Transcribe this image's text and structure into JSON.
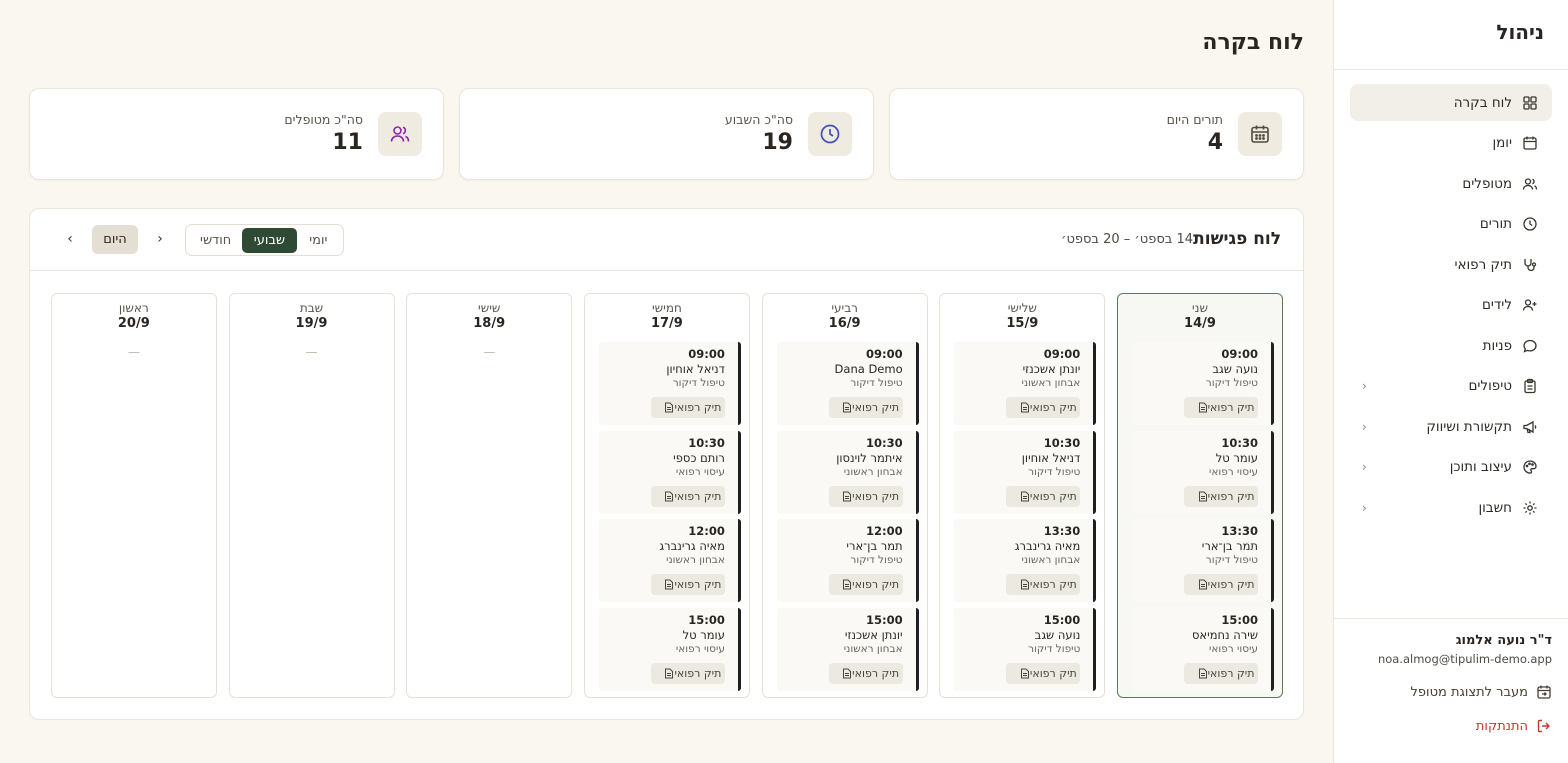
{
  "sidebar": {
    "title": "ניהול",
    "items": [
      {
        "label": "לוח בקרה",
        "icon": "dashboard-icon"
      },
      {
        "label": "יומן",
        "icon": "calendar-icon"
      },
      {
        "label": "מטופלים",
        "icon": "users-icon"
      },
      {
        "label": "תורים",
        "icon": "clock-icon"
      },
      {
        "label": "תיק רפואי",
        "icon": "stethoscope-icon"
      },
      {
        "label": "לידים",
        "icon": "user-plus-icon"
      },
      {
        "label": "פניות",
        "icon": "message-icon"
      },
      {
        "label": "טיפולים",
        "icon": "clipboard-icon",
        "chevron": "‹"
      },
      {
        "label": "תקשורת ושיווק",
        "icon": "megaphone-icon",
        "chevron": "‹"
      },
      {
        "label": "עיצוב ותוכן",
        "icon": "palette-icon",
        "chevron": "‹"
      },
      {
        "label": "חשבון",
        "icon": "gear-icon",
        "chevron": "‹"
      }
    ],
    "user": {
      "name": "ד\"ר נועה אלמוג",
      "email": "noa.almog@tipulim-demo.app"
    },
    "switch_label": "מעבר לתצוגת מטופל",
    "logout_label": "התנתקות"
  },
  "main": {
    "title": "לוח בקרה",
    "stats": [
      {
        "label": "תורים היום",
        "value": "4",
        "icon": "calendar-icon",
        "color": "#5a5a4a",
        "bg": "#efebe0"
      },
      {
        "label": "סה\"כ השבוע",
        "value": "19",
        "icon": "clock-icon",
        "color": "#3f51b5",
        "bg": "#efebe0"
      },
      {
        "label": "סה\"כ מטופלים",
        "value": "11",
        "icon": "users-icon",
        "color": "#8e24aa",
        "bg": "#efebe0"
      }
    ],
    "board": {
      "title": "לוח פגישות",
      "range": "14 בספט׳ – 20 בספט׳",
      "views": [
        "יומי",
        "שבועי",
        "חודשי"
      ],
      "active_view": "שבועי",
      "today_label": "היום",
      "prev_glyph": "‹",
      "next_glyph": "›"
    },
    "file_button_label": "תיק רפואי",
    "empty_marker": "—",
    "days": [
      {
        "name": "שני",
        "date": "14/9",
        "today": true,
        "appointments": [
          {
            "time": "09:00",
            "patient": "נועה שגב",
            "type": "טיפול דיקור"
          },
          {
            "time": "10:30",
            "patient": "עומר טל",
            "type": "עיסוי רפואי"
          },
          {
            "time": "13:30",
            "patient": "תמר בן־ארי",
            "type": "טיפול דיקור"
          },
          {
            "time": "15:00",
            "patient": "שירה נחמיאס",
            "type": "עיסוי רפואי"
          }
        ]
      },
      {
        "name": "שלישי",
        "date": "15/9",
        "today": false,
        "appointments": [
          {
            "time": "09:00",
            "patient": "יונתן אשכנזי",
            "type": "אבחון ראשוני"
          },
          {
            "time": "10:30",
            "patient": "דניאל אוחיון",
            "type": "טיפול דיקור"
          },
          {
            "time": "13:30",
            "patient": "מאיה גרינברג",
            "type": "אבחון ראשוני"
          },
          {
            "time": "15:00",
            "patient": "נועה שגב",
            "type": "טיפול דיקור"
          }
        ]
      },
      {
        "name": "רביעי",
        "date": "16/9",
        "today": false,
        "appointments": [
          {
            "time": "09:00",
            "patient": "Dana Demo",
            "type": "טיפול דיקור"
          },
          {
            "time": "10:30",
            "patient": "איתמר לוינסון",
            "type": "אבחון ראשוני"
          },
          {
            "time": "12:00",
            "patient": "תמר בן־ארי",
            "type": "טיפול דיקור"
          },
          {
            "time": "15:00",
            "patient": "יונתן אשכנזי",
            "type": "אבחון ראשוני"
          }
        ]
      },
      {
        "name": "חמישי",
        "date": "17/9",
        "today": false,
        "appointments": [
          {
            "time": "09:00",
            "patient": "דניאל אוחיון",
            "type": "טיפול דיקור"
          },
          {
            "time": "10:30",
            "patient": "רותם כספי",
            "type": "עיסוי רפואי"
          },
          {
            "time": "12:00",
            "patient": "מאיה גרינברג",
            "type": "אבחון ראשוני"
          },
          {
            "time": "15:00",
            "patient": "עומר טל",
            "type": "עיסוי רפואי"
          }
        ]
      },
      {
        "name": "שישי",
        "date": "18/9",
        "today": false,
        "appointments": []
      },
      {
        "name": "שבת",
        "date": "19/9",
        "today": false,
        "appointments": []
      },
      {
        "name": "ראשון",
        "date": "20/9",
        "today": false,
        "appointments": []
      }
    ]
  }
}
